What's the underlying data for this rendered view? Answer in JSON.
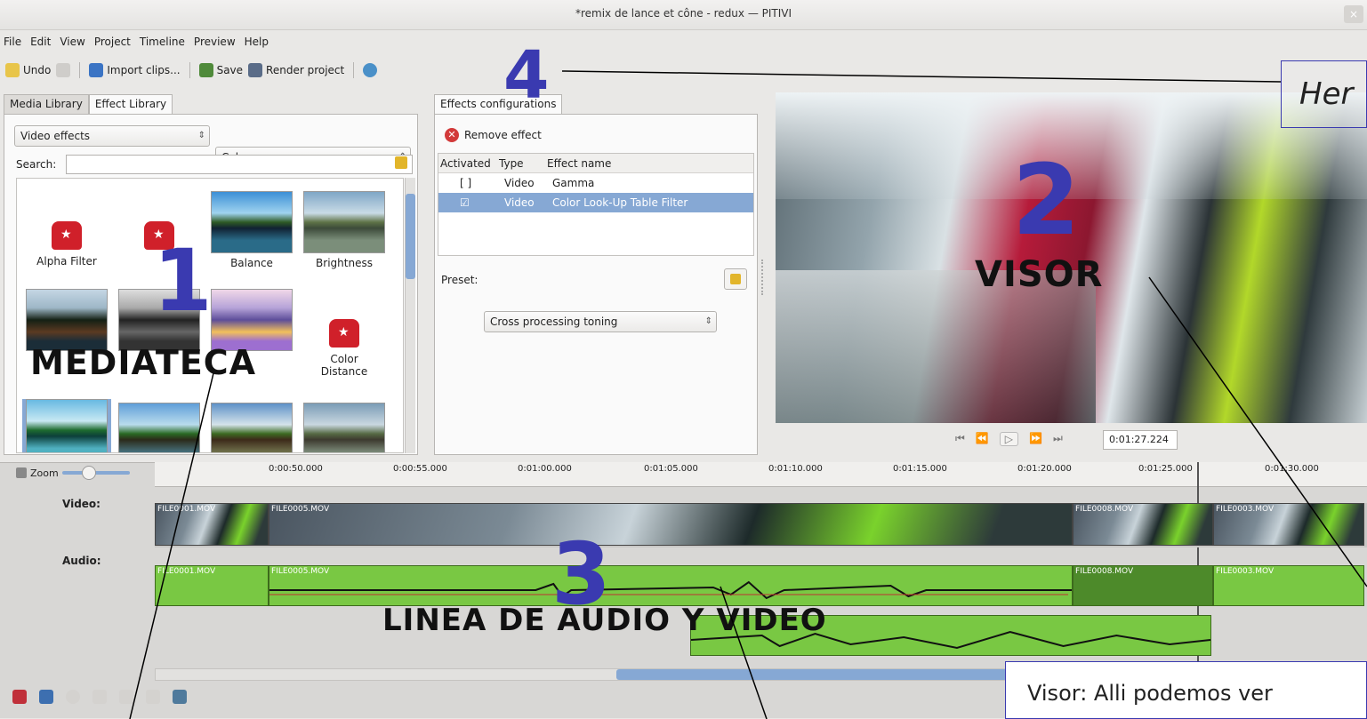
{
  "window": {
    "title": "*remix de lance et cône - redux — PITIVI",
    "close": "×"
  },
  "menu": [
    "File",
    "Edit",
    "View",
    "Project",
    "Timeline",
    "Preview",
    "Help"
  ],
  "toolbar": {
    "undo": "Undo",
    "import": "Import clips...",
    "save": "Save",
    "render": "Render project"
  },
  "left_panel": {
    "tabs": [
      "Media Library",
      "Effect Library"
    ],
    "category": "Video effects",
    "subcategory": "Colors",
    "search_label": "Search:",
    "search_value": "",
    "effects": [
      "Alpha Filter",
      "Balance",
      "Brightness",
      "Color Distance"
    ]
  },
  "effects_panel": {
    "tab": "Effects configurations",
    "remove": "Remove effect",
    "columns": [
      "Activated",
      "Type",
      "Effect name"
    ],
    "rows": [
      {
        "activated": "[ ]",
        "type": "Video",
        "name": "Gamma"
      },
      {
        "activated": "☑",
        "type": "Video",
        "name": "Color Look-Up Table Filter"
      }
    ],
    "preset_label": "Preset:",
    "preset_value": "Cross processing toning"
  },
  "viewer": {
    "timecode": "0:01:27.224",
    "controls": [
      "⏮",
      "⏪",
      "▷",
      "⏩",
      "⏭"
    ]
  },
  "timeline": {
    "zoom_label": "Zoom",
    "ruler": [
      "0:00:50.000",
      "0:00:55.000",
      "0:01:00.000",
      "0:01:05.000",
      "0:01:10.000",
      "0:01:15.000",
      "0:01:20.000",
      "0:01:25.000",
      "0:01:30.000"
    ],
    "track_labels": [
      "Video:",
      "Audio:"
    ],
    "video_clips": [
      "FILE0001.MOV",
      "FILE0005.MOV",
      "FILE0008.MOV",
      "FILE0003.MOV"
    ],
    "audio_clips": [
      "FILE0001.MOV",
      "FILE0005.MOV",
      "FILE0008.MOV",
      "FILE0003.MOV"
    ]
  },
  "annotations": {
    "n1": "1",
    "l1": "MEDIATECA",
    "n2": "2",
    "l2": "VISOR",
    "n3": "3",
    "l3": "LINEA DE AUDIO Y VIDEO",
    "n4": "4",
    "her": "Her",
    "visor_note": "Visor: Alli podemos ver"
  },
  "colors": {
    "accent_blue": "#3a3ab0",
    "selection": "#86a8d4",
    "audio_green": "#79c843"
  }
}
